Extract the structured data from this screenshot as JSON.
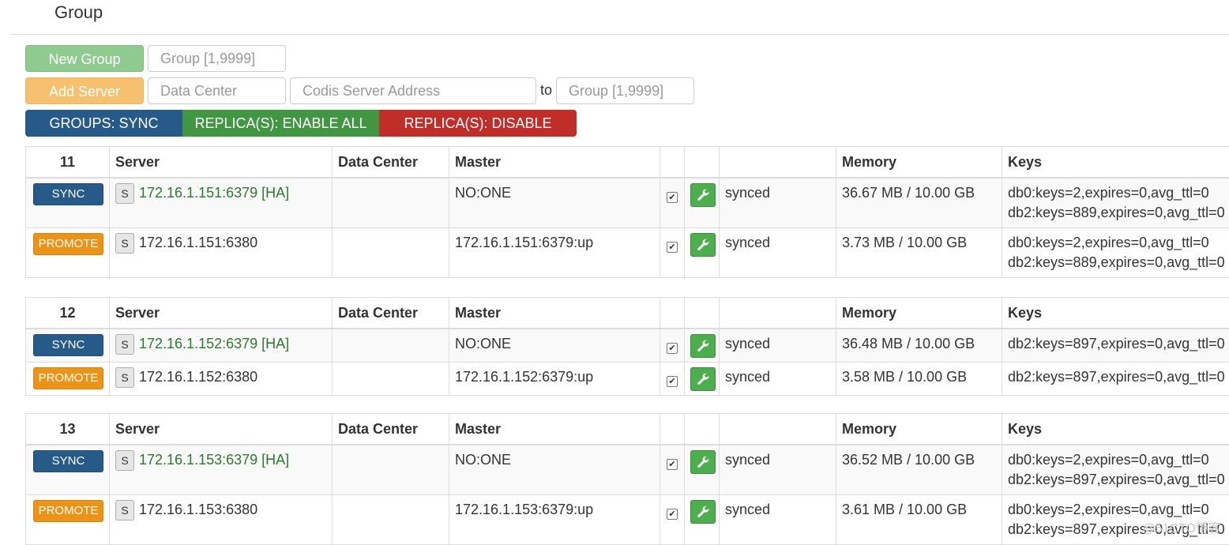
{
  "page_title": "Group",
  "toolbar": {
    "new_group_label": "New Group",
    "group_placeholder": "Group [1,9999]",
    "add_server_label": "Add Server",
    "data_center_placeholder": "Data Center",
    "server_address_placeholder": "Codis Server Address",
    "to_label": "to",
    "target_group_placeholder": "Group [1,9999]",
    "sync_all_label": "GROUPS: SYNC ALL",
    "enable_all_label": "REPLICA(S): ENABLE ALL",
    "disable_all_label": "REPLICA(S): DISABLE ALL"
  },
  "columns": {
    "server": "Server",
    "data_center": "Data Center",
    "master": "Master",
    "memory": "Memory",
    "keys": "Keys"
  },
  "groups": [
    {
      "id": "11",
      "rows": [
        {
          "action": "SYNC",
          "badge": "S",
          "server": "172.16.1.151:6379 [HA]",
          "data_center": "",
          "master": "NO:ONE",
          "checked": true,
          "status": "synced",
          "memory": "36.67 MB / 10.00 GB",
          "keys": [
            "db0:keys=2,expires=0,avg_ttl=0",
            "db2:keys=889,expires=0,avg_ttl=0"
          ]
        },
        {
          "action": "PROMOTE",
          "badge": "S",
          "server": "172.16.1.151:6380",
          "data_center": "",
          "master": "172.16.1.151:6379:up",
          "checked": true,
          "status": "synced",
          "memory": "3.73 MB / 10.00 GB",
          "keys": [
            "db0:keys=2,expires=0,avg_ttl=0",
            "db2:keys=889,expires=0,avg_ttl=0"
          ]
        }
      ]
    },
    {
      "id": "12",
      "rows": [
        {
          "action": "SYNC",
          "badge": "S",
          "server": "172.16.1.152:6379 [HA]",
          "data_center": "",
          "master": "NO:ONE",
          "checked": true,
          "status": "synced",
          "memory": "36.48 MB / 10.00 GB",
          "keys": [
            "db2:keys=897,expires=0,avg_ttl=0"
          ]
        },
        {
          "action": "PROMOTE",
          "badge": "S",
          "server": "172.16.1.152:6380",
          "data_center": "",
          "master": "172.16.1.152:6379:up",
          "checked": true,
          "status": "synced",
          "memory": "3.58 MB / 10.00 GB",
          "keys": [
            "db2:keys=897,expires=0,avg_ttl=0"
          ]
        }
      ]
    },
    {
      "id": "13",
      "rows": [
        {
          "action": "SYNC",
          "badge": "S",
          "server": "172.16.1.153:6379 [HA]",
          "data_center": "",
          "master": "NO:ONE",
          "checked": true,
          "status": "synced",
          "memory": "36.52 MB / 10.00 GB",
          "keys": [
            "db0:keys=2,expires=0,avg_ttl=0",
            "db2:keys=897,expires=0,avg_ttl=0"
          ]
        },
        {
          "action": "PROMOTE",
          "badge": "S",
          "server": "172.16.1.153:6380",
          "data_center": "",
          "master": "172.16.1.153:6379:up",
          "checked": true,
          "status": "synced",
          "memory": "3.61 MB / 10.00 GB",
          "keys": [
            "db0:keys=2,expires=0,avg_ttl=0",
            "db2:keys=897,expires=0,avg_ttl=0"
          ]
        }
      ]
    }
  ],
  "watermark": "@51CTO博客",
  "icons": {
    "check": "checkbox-checked-icon",
    "config": "wrench-icon"
  },
  "colors": {
    "sync": "#265a88",
    "promote": "#eb9316",
    "enable": "#419641",
    "disable": "#c12e2a",
    "master_server_text": "#2b7a2b"
  }
}
